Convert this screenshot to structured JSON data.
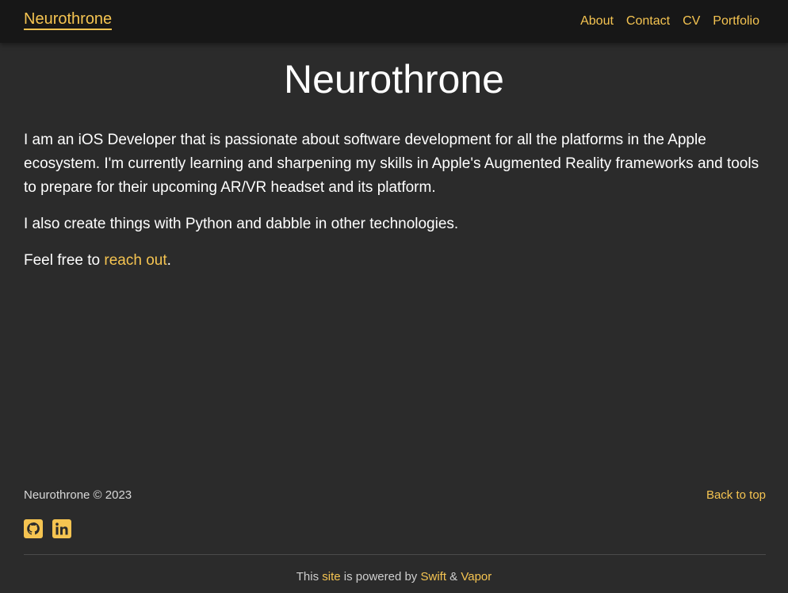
{
  "nav": {
    "brand": "Neurothrone",
    "links": [
      "About",
      "Contact",
      "CV",
      "Portfolio"
    ]
  },
  "main": {
    "title": "Neurothrone",
    "paragraphs": [
      "I am an iOS Developer that is passionate about software development for all the platforms in the Apple ecosystem. I'm currently learning and sharpening my skills in Apple's Augmented Reality frameworks and tools to prepare for their upcoming AR/VR headset and its platform.",
      "I also create things with Python and dabble in other technologies."
    ],
    "cta_prefix": "Feel free to ",
    "cta_link": "reach out",
    "cta_suffix": "."
  },
  "footer": {
    "copyright": "Neurothrone © 2023",
    "back_to_top": "Back to top",
    "social_icons": [
      "github-icon",
      "linkedin-icon"
    ],
    "powered_prefix": "This ",
    "powered_site": "site",
    "powered_mid": " is powered by ",
    "powered_swift": "Swift",
    "powered_amp": " & ",
    "powered_vapor": "Vapor"
  },
  "colors": {
    "background": "#2b2b2b",
    "navbar": "#171717",
    "accent": "#f5c451",
    "text": "#ffffff"
  }
}
